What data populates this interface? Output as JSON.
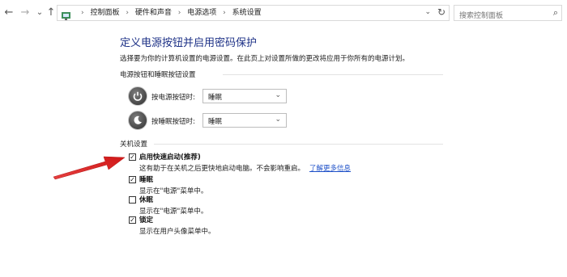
{
  "nav": {
    "back": "←",
    "forward": "→",
    "recent": "⌄",
    "up": "↑",
    "breadcrumb": [
      "控制面板",
      "硬件和声音",
      "电源选项",
      "系统设置"
    ],
    "search_placeholder": "搜索控制面板"
  },
  "page": {
    "title": "定义电源按钮并启用密码保护",
    "description": "选择要为你的计算机设置的电源设置。在此页上对设置所做的更改将应用于你所有的电源计划。"
  },
  "buttons_section": {
    "heading": "电源按钮和睡眠按钮设置",
    "rows": [
      {
        "label": "按电源按钮时:",
        "value": "睡眠",
        "icon": "power-button-icon"
      },
      {
        "label": "按睡眠按钮时:",
        "value": "睡眠",
        "icon": "sleep-button-icon"
      }
    ]
  },
  "shutdown_section": {
    "heading": "关机设置",
    "options": [
      {
        "label": "启用快速启动(推荐)",
        "checked": true,
        "desc": "这有助于在关机之后更快地启动电脑。不会影响重启。",
        "link": "了解更多信息"
      },
      {
        "label": "睡眠",
        "checked": true,
        "desc": "显示在\"电源\"菜单中。"
      },
      {
        "label": "休眠",
        "checked": false,
        "desc": "显示在\"电源\"菜单中。"
      },
      {
        "label": "锁定",
        "checked": true,
        "desc": "显示在用户头像菜单中。"
      }
    ]
  },
  "colors": {
    "title": "#1e3287",
    "link": "#1e50c8",
    "arrow": "#e02020"
  }
}
